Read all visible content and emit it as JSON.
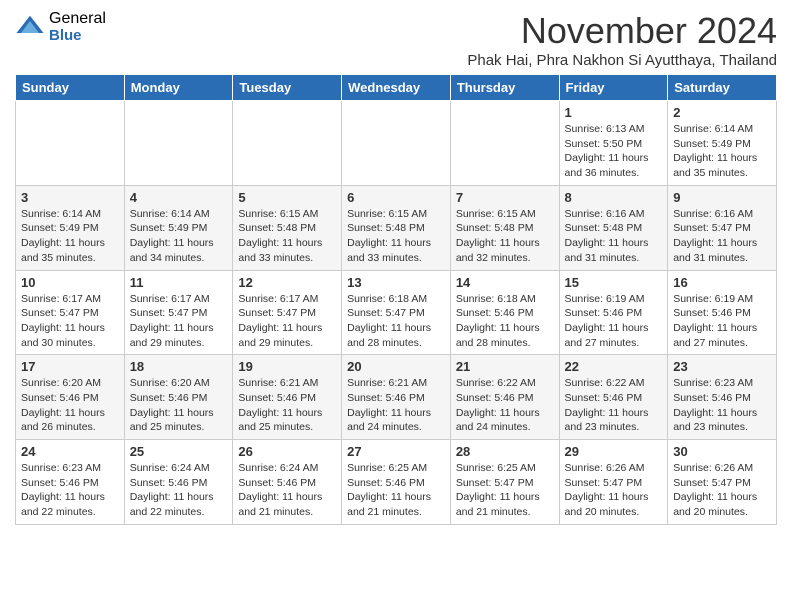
{
  "logo": {
    "general": "General",
    "blue": "Blue"
  },
  "title": "November 2024",
  "subtitle": "Phak Hai, Phra Nakhon Si Ayutthaya, Thailand",
  "days_of_week": [
    "Sunday",
    "Monday",
    "Tuesday",
    "Wednesday",
    "Thursday",
    "Friday",
    "Saturday"
  ],
  "weeks": [
    [
      {
        "day": "",
        "info": ""
      },
      {
        "day": "",
        "info": ""
      },
      {
        "day": "",
        "info": ""
      },
      {
        "day": "",
        "info": ""
      },
      {
        "day": "",
        "info": ""
      },
      {
        "day": "1",
        "info": "Sunrise: 6:13 AM\nSunset: 5:50 PM\nDaylight: 11 hours and 36 minutes."
      },
      {
        "day": "2",
        "info": "Sunrise: 6:14 AM\nSunset: 5:49 PM\nDaylight: 11 hours and 35 minutes."
      }
    ],
    [
      {
        "day": "3",
        "info": "Sunrise: 6:14 AM\nSunset: 5:49 PM\nDaylight: 11 hours and 35 minutes."
      },
      {
        "day": "4",
        "info": "Sunrise: 6:14 AM\nSunset: 5:49 PM\nDaylight: 11 hours and 34 minutes."
      },
      {
        "day": "5",
        "info": "Sunrise: 6:15 AM\nSunset: 5:48 PM\nDaylight: 11 hours and 33 minutes."
      },
      {
        "day": "6",
        "info": "Sunrise: 6:15 AM\nSunset: 5:48 PM\nDaylight: 11 hours and 33 minutes."
      },
      {
        "day": "7",
        "info": "Sunrise: 6:15 AM\nSunset: 5:48 PM\nDaylight: 11 hours and 32 minutes."
      },
      {
        "day": "8",
        "info": "Sunrise: 6:16 AM\nSunset: 5:48 PM\nDaylight: 11 hours and 31 minutes."
      },
      {
        "day": "9",
        "info": "Sunrise: 6:16 AM\nSunset: 5:47 PM\nDaylight: 11 hours and 31 minutes."
      }
    ],
    [
      {
        "day": "10",
        "info": "Sunrise: 6:17 AM\nSunset: 5:47 PM\nDaylight: 11 hours and 30 minutes."
      },
      {
        "day": "11",
        "info": "Sunrise: 6:17 AM\nSunset: 5:47 PM\nDaylight: 11 hours and 29 minutes."
      },
      {
        "day": "12",
        "info": "Sunrise: 6:17 AM\nSunset: 5:47 PM\nDaylight: 11 hours and 29 minutes."
      },
      {
        "day": "13",
        "info": "Sunrise: 6:18 AM\nSunset: 5:47 PM\nDaylight: 11 hours and 28 minutes."
      },
      {
        "day": "14",
        "info": "Sunrise: 6:18 AM\nSunset: 5:46 PM\nDaylight: 11 hours and 28 minutes."
      },
      {
        "day": "15",
        "info": "Sunrise: 6:19 AM\nSunset: 5:46 PM\nDaylight: 11 hours and 27 minutes."
      },
      {
        "day": "16",
        "info": "Sunrise: 6:19 AM\nSunset: 5:46 PM\nDaylight: 11 hours and 27 minutes."
      }
    ],
    [
      {
        "day": "17",
        "info": "Sunrise: 6:20 AM\nSunset: 5:46 PM\nDaylight: 11 hours and 26 minutes."
      },
      {
        "day": "18",
        "info": "Sunrise: 6:20 AM\nSunset: 5:46 PM\nDaylight: 11 hours and 25 minutes."
      },
      {
        "day": "19",
        "info": "Sunrise: 6:21 AM\nSunset: 5:46 PM\nDaylight: 11 hours and 25 minutes."
      },
      {
        "day": "20",
        "info": "Sunrise: 6:21 AM\nSunset: 5:46 PM\nDaylight: 11 hours and 24 minutes."
      },
      {
        "day": "21",
        "info": "Sunrise: 6:22 AM\nSunset: 5:46 PM\nDaylight: 11 hours and 24 minutes."
      },
      {
        "day": "22",
        "info": "Sunrise: 6:22 AM\nSunset: 5:46 PM\nDaylight: 11 hours and 23 minutes."
      },
      {
        "day": "23",
        "info": "Sunrise: 6:23 AM\nSunset: 5:46 PM\nDaylight: 11 hours and 23 minutes."
      }
    ],
    [
      {
        "day": "24",
        "info": "Sunrise: 6:23 AM\nSunset: 5:46 PM\nDaylight: 11 hours and 22 minutes."
      },
      {
        "day": "25",
        "info": "Sunrise: 6:24 AM\nSunset: 5:46 PM\nDaylight: 11 hours and 22 minutes."
      },
      {
        "day": "26",
        "info": "Sunrise: 6:24 AM\nSunset: 5:46 PM\nDaylight: 11 hours and 21 minutes."
      },
      {
        "day": "27",
        "info": "Sunrise: 6:25 AM\nSunset: 5:46 PM\nDaylight: 11 hours and 21 minutes."
      },
      {
        "day": "28",
        "info": "Sunrise: 6:25 AM\nSunset: 5:47 PM\nDaylight: 11 hours and 21 minutes."
      },
      {
        "day": "29",
        "info": "Sunrise: 6:26 AM\nSunset: 5:47 PM\nDaylight: 11 hours and 20 minutes."
      },
      {
        "day": "30",
        "info": "Sunrise: 6:26 AM\nSunset: 5:47 PM\nDaylight: 11 hours and 20 minutes."
      }
    ]
  ]
}
